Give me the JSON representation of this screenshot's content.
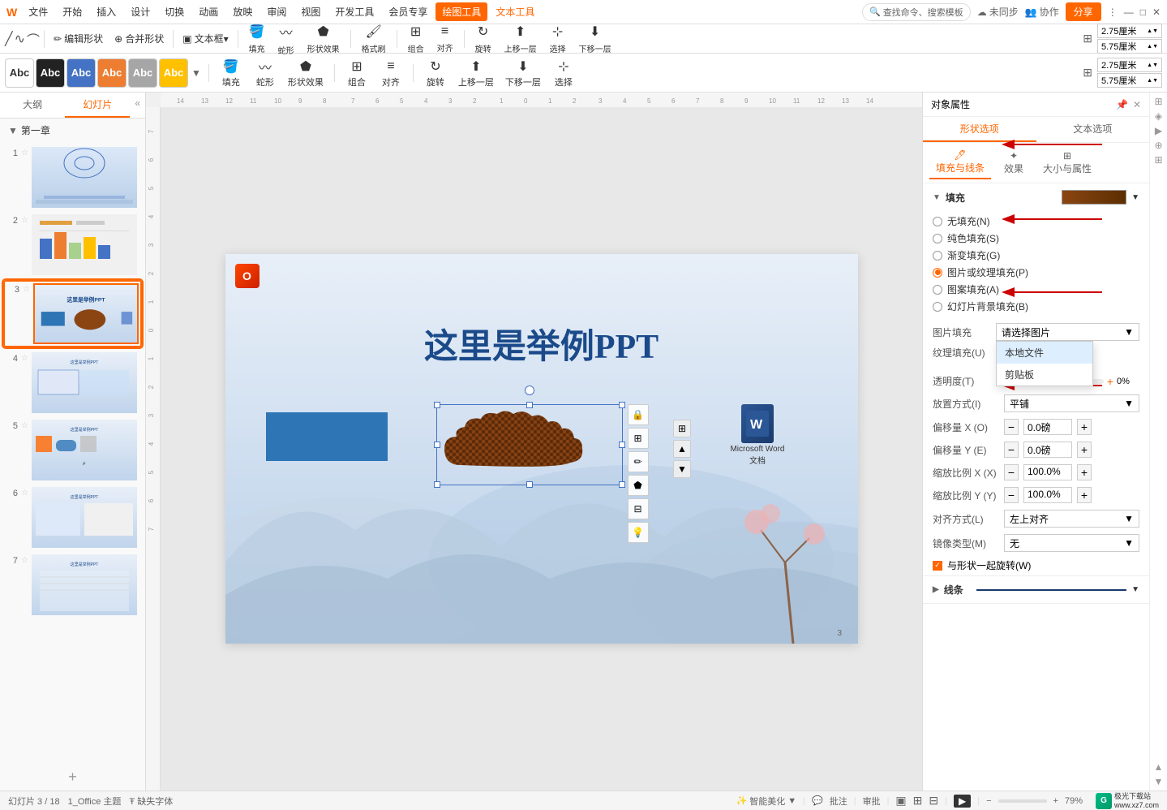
{
  "titleBar": {
    "menus": [
      "文件",
      "开始",
      "插入",
      "设计",
      "切换",
      "动画",
      "放映",
      "审阅",
      "视图",
      "开发工具",
      "会员专享",
      "绘图工具",
      "文本工具"
    ],
    "activeMenu": "绘图工具",
    "activeMenu2": "文本工具",
    "searchPlaceholder": "查找命令、搜索模板",
    "sync": "未同步",
    "collab": "协作",
    "share": "分享"
  },
  "toolbar1": {
    "editShape": "编辑形状",
    "mergeShape": "合并形状",
    "textBox": "▣ 文本框 *",
    "fillLabel": "填充",
    "snakeLabel": "蛇形",
    "shapeEffect": "形状效果",
    "formatBrush": "格式刷",
    "group": "组合",
    "align": "对齐",
    "rotate": "旋转",
    "moveUp": "上移一层",
    "moveDown": "下移一层",
    "select": "选择",
    "width": "2.75厘米",
    "height": "5.75厘米"
  },
  "toolbar2": {
    "styles": [
      "Abc",
      "Abc",
      "Abc",
      "Abc",
      "Abc",
      "Abc"
    ],
    "styleColors": [
      "white",
      "dark",
      "blue",
      "orange",
      "gray",
      "yellow"
    ]
  },
  "leftPanel": {
    "tabs": [
      "大纲",
      "幻灯片"
    ],
    "activeTab": "幻灯片",
    "chapterLabel": "第一章",
    "slides": [
      {
        "num": "1",
        "star": "★"
      },
      {
        "num": "2",
        "star": "★"
      },
      {
        "num": "3",
        "star": "★"
      },
      {
        "num": "4",
        "star": "★"
      },
      {
        "num": "5",
        "star": "★"
      },
      {
        "num": "6",
        "star": "★"
      },
      {
        "num": "7",
        "star": "★"
      }
    ],
    "addBtn": "+"
  },
  "slideCanvas": {
    "title": "这里是举例PPT",
    "officeIcon": "Office"
  },
  "rightPanel": {
    "title": "对象属性",
    "pinIcon": "📌",
    "closeIcon": "✕",
    "tabs": [
      "形状选项",
      "文本选项"
    ],
    "activeTab": "形状选项",
    "fillSection": {
      "label": "填充与线条",
      "subsections": [
        "效果",
        "大小与属性"
      ]
    },
    "fill": {
      "label": "填充",
      "options": [
        {
          "id": "none",
          "label": "无填充(N)"
        },
        {
          "id": "solid",
          "label": "纯色填充(S)"
        },
        {
          "id": "gradient",
          "label": "渐变填充(G)"
        },
        {
          "id": "picture",
          "label": "图片或纹理填充(P)",
          "checked": true
        },
        {
          "id": "pattern",
          "label": "图案填充(A)"
        },
        {
          "id": "slide_bg",
          "label": "幻灯片背景填充(B)"
        }
      ],
      "imageFill": {
        "label": "图片填充",
        "placeholder": "请选择图片",
        "dropdownItems": [
          "本地文件",
          "剪贴板"
        ],
        "highlightedItem": "本地文件"
      },
      "textureFill": {
        "label": "纹理填充(U)"
      },
      "transparency": {
        "label": "透明度(T)",
        "value": "0%",
        "progressValue": 0
      },
      "placement": {
        "label": "放置方式(I)",
        "value": "平铺"
      },
      "offsetX": {
        "label": "偏移量 X (O)",
        "value": "0.0磅"
      },
      "offsetY": {
        "label": "偏移量 Y (E)",
        "value": "0.0磅"
      },
      "scaleX": {
        "label": "缩放比例 X (X)",
        "value": "100.0%"
      },
      "scaleY": {
        "label": "缩放比例 Y (Y)",
        "value": "100.0%"
      },
      "align": {
        "label": "对齐方式(L)",
        "value": "左上对齐"
      },
      "mirror": {
        "label": "镜像类型(M)",
        "value": "无"
      },
      "rotateWithShape": {
        "label": "与形状一起旋转(W)",
        "checked": true
      }
    },
    "lineSection": {
      "label": "线条"
    }
  },
  "statusBar": {
    "slideInfo": "幻灯片 3 / 18",
    "theme": "1_Office 主题",
    "missingFont": "缺失字体",
    "beautify": "智能美化",
    "comment": "批注",
    "review": "审批",
    "zoomLevel": "79%",
    "brandName": "极光下载站",
    "brandUrl": "www.xz7.com"
  },
  "redArrows": [
    {
      "label": "填充与线条"
    },
    {
      "label": "填充"
    },
    {
      "label": "图片或纹理填充"
    },
    {
      "label": "本地文件"
    }
  ]
}
